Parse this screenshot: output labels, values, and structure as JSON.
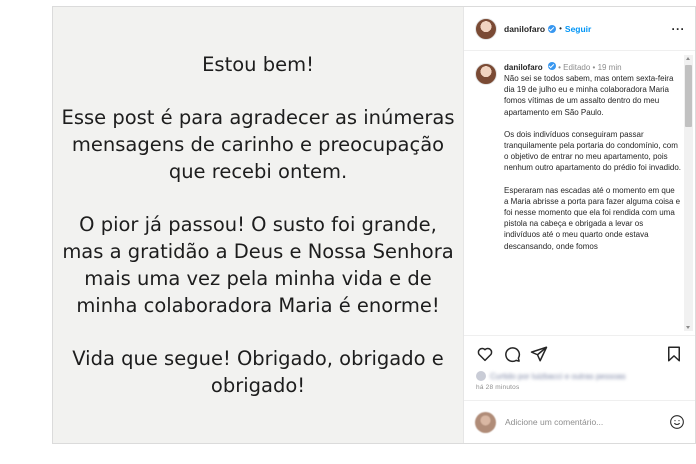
{
  "image_text": {
    "paragraphs": [
      "Estou bem!",
      "Esse post é para agradecer as inúmeras mensagens de carinho e preocupação que recebi ontem.",
      "O pior já passou! O susto foi grande, mas a gratidão a Deus e Nossa Senhora mais uma vez pela minha vida e de minha colaboradora Maria é enorme!",
      "Vida que segue! Obrigado, obrigado e obrigado!"
    ]
  },
  "header": {
    "username": "danilofaro",
    "separator": "•",
    "follow_label": "Seguir",
    "more_label": "···"
  },
  "caption": {
    "username": "danilofaro",
    "edited_label": "• Editado •",
    "time": "19 min",
    "paragraphs": [
      "Não sei se todos sabem, mas ontem sexta-feira dia 19 de julho eu e minha colaboradora Maria fomos vítimas de um assalto dentro do meu apartamento em São Paulo.",
      "Os dois indivíduos conseguiram passar tranquilamente pela portaria do condomínio, com o objetivo de entrar no meu apartamento, pois nenhum outro apartamento do prédio foi invadido.",
      "Esperaram nas escadas até o momento em que a Maria abrisse a porta para fazer alguma coisa e foi nesse momento que ela foi rendida com uma pistola na cabeça e obrigada a levar os indivíduos até o meu quarto onde estava descansando, onde fomos"
    ]
  },
  "actions": {
    "icons": [
      "heart-icon",
      "comment-icon",
      "share-icon",
      "bookmark-icon"
    ],
    "likes_text": "Curtido por luizbacci e outras pessoas",
    "time_ago": "há 28 minutos"
  },
  "comment": {
    "placeholder": "Adicione um comentário...",
    "emoji_icon": "smiley-icon"
  },
  "colors": {
    "link_blue": "#0095f6",
    "verified_blue": "#3897f0",
    "image_background": "#f2f2f0",
    "muted_text": "#8e8e8e"
  }
}
